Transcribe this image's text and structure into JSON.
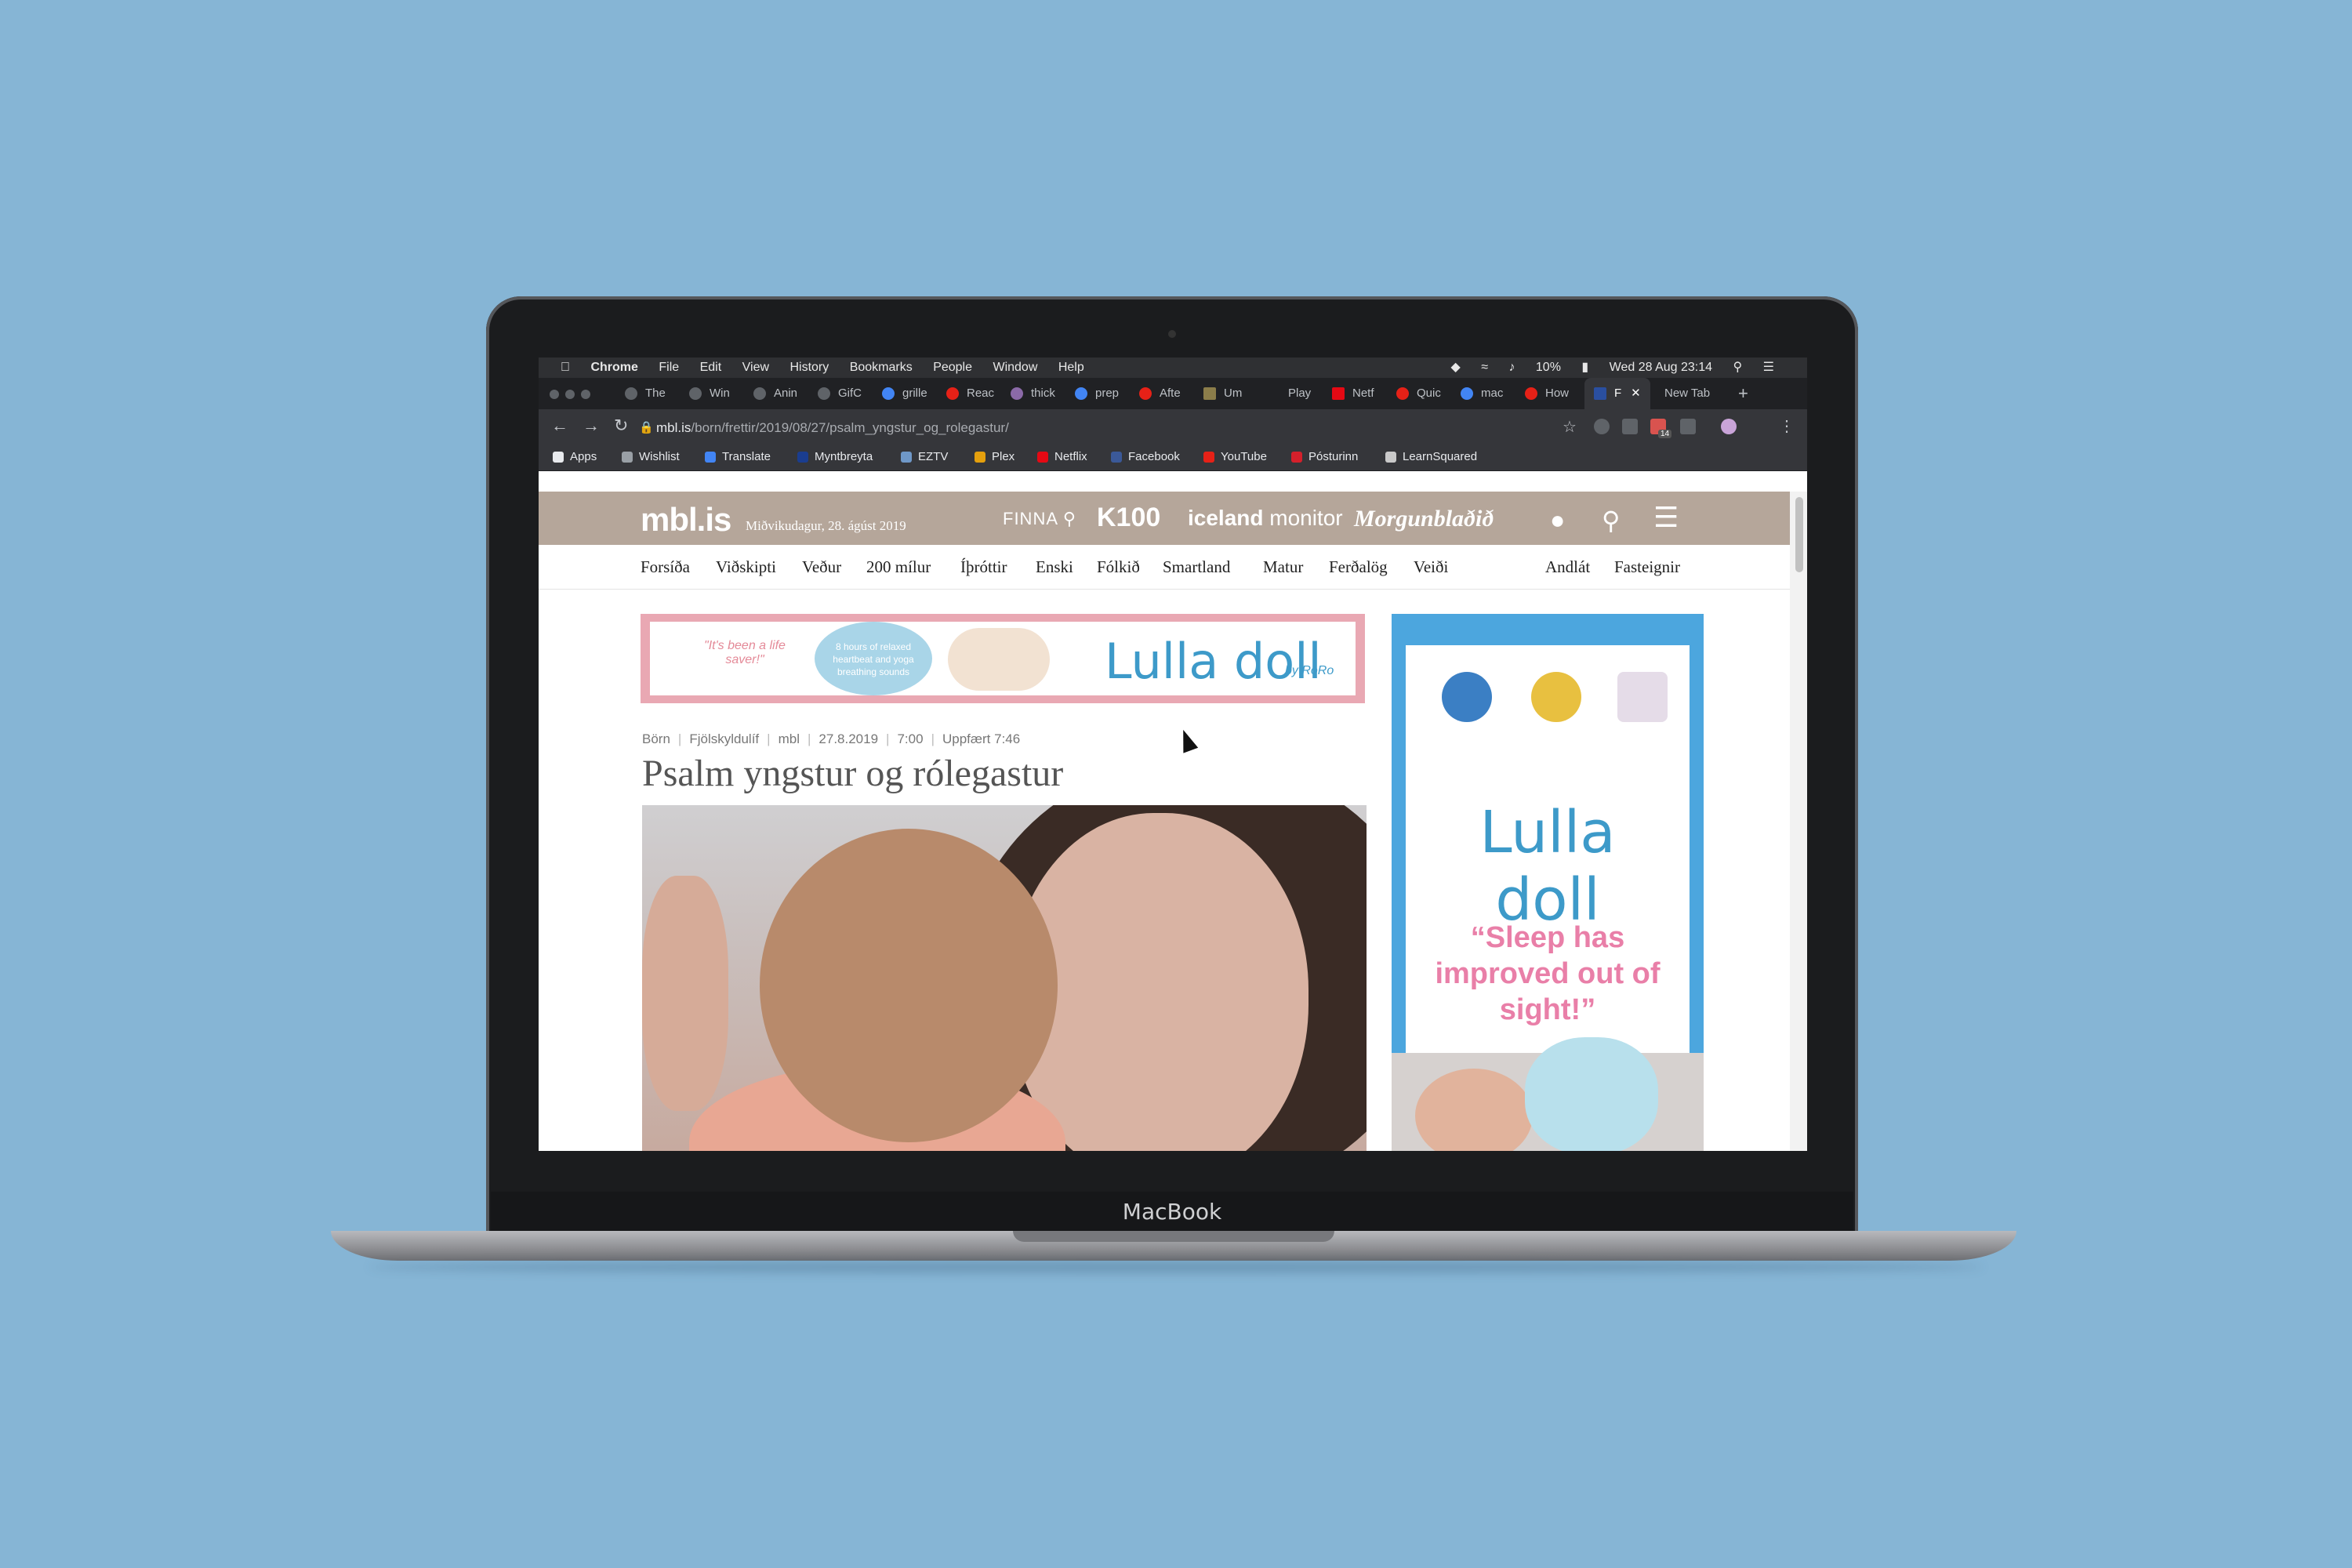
{
  "device": {
    "label": "MacBook"
  },
  "menubar": {
    "app_name": "Chrome",
    "menus": [
      "File",
      "Edit",
      "View",
      "History",
      "Bookmarks",
      "People",
      "Window",
      "Help"
    ],
    "battery": "10%",
    "clock": "Wed 28 Aug  23:14"
  },
  "tabs": [
    {
      "label": "The"
    },
    {
      "label": "Win"
    },
    {
      "label": "Anin"
    },
    {
      "label": "GifC"
    },
    {
      "label": "grille"
    },
    {
      "label": "Reac"
    },
    {
      "label": "thick"
    },
    {
      "label": "prep"
    },
    {
      "label": "Afte"
    },
    {
      "label": "Um"
    },
    {
      "label": "Play"
    },
    {
      "label": "Netf"
    },
    {
      "label": "Quic"
    },
    {
      "label": "mac"
    },
    {
      "label": "How"
    },
    {
      "label": "F"
    },
    {
      "label": "New Tab"
    }
  ],
  "addressbar": {
    "host": "mbl.is",
    "path": "/born/frettir/2019/08/27/psalm_yngstur_og_rolegastur/",
    "extension_badge": "14"
  },
  "bookmarks": [
    {
      "label": "Apps"
    },
    {
      "label": "Wishlist"
    },
    {
      "label": "Translate"
    },
    {
      "label": "Myntbreyta"
    },
    {
      "label": "EZTV"
    },
    {
      "label": "Plex"
    },
    {
      "label": "Netflix"
    },
    {
      "label": "Facebook"
    },
    {
      "label": "YouTube"
    },
    {
      "label": "Pósturinn"
    },
    {
      "label": "LearnSquared"
    }
  ],
  "site": {
    "logo": "mbl.is",
    "date": "Miðvikudagur, 28. ágúst 2019",
    "partners": {
      "finna": "FINNA",
      "k100": "K100",
      "iceland_bold": "iceland",
      "iceland_rest": " monitor",
      "morgunbladid": "Morgunblaðið"
    },
    "nav": [
      "Forsíða",
      "Viðskipti",
      "Veður",
      "200 mílur",
      "Íþróttir",
      "Enski",
      "Fólkið",
      "Smartland",
      "Matur",
      "Ferðalög",
      "Veiði"
    ],
    "nav_right": [
      "Andlát",
      "Fasteignir"
    ]
  },
  "banner_ad": {
    "quote": "\"It's been a life saver!\"",
    "bubble": "8 hours of relaxed heartbeat and yoga breathing sounds",
    "brand": "Lulla doll",
    "by": "by RoRo"
  },
  "article": {
    "meta": [
      "Börn",
      "Fjölskyldulíf",
      "mbl",
      "27.8.2019",
      "7:00",
      "Uppfært 7:46"
    ],
    "headline": "Psalm yngstur og rólegastur"
  },
  "side_ad": {
    "brand": "Lulla doll",
    "quote": "“Sleep has improved out of sight!”"
  },
  "colors": {
    "site_header": "#b5a69a",
    "ad_blue": "#4ca6de",
    "ad_pink": "#e97fa8",
    "background": "#86b5d5"
  }
}
